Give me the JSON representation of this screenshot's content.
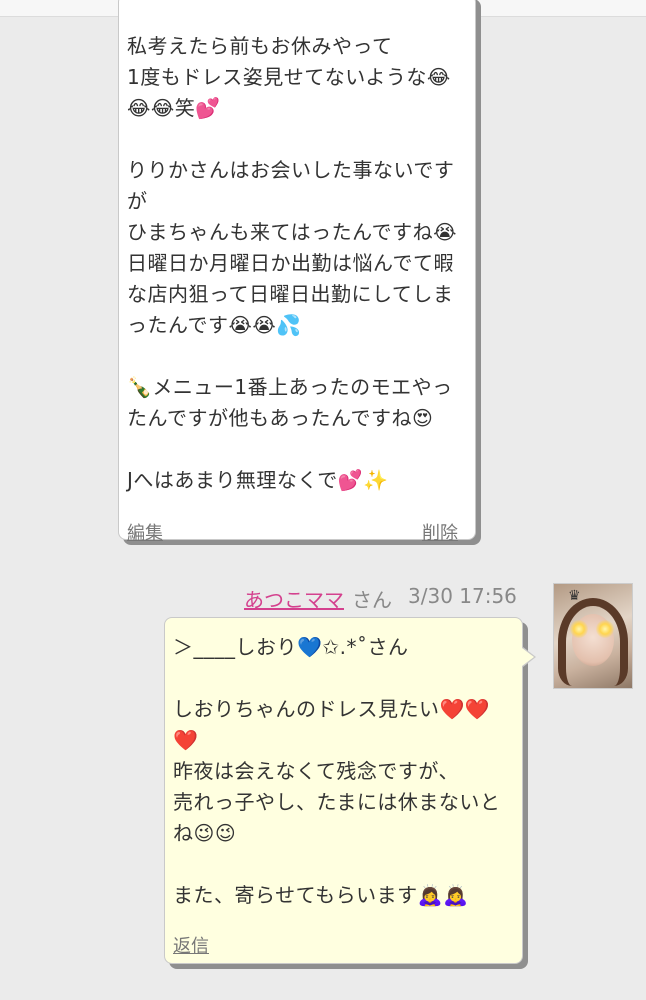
{
  "message1": {
    "lines": [
      "私考えたら前もお休みやって",
      "1度もドレス姿見せてないような😂",
      "😂😂笑💕",
      "",
      "りりかさんはお会いした事ないです",
      "が",
      "ひまちゃんも来てはったんですね😭",
      "日曜日か月曜日か出勤は悩んでて暇",
      "な店内狙って日曜日出勤にしてしま",
      "ったんです😭😭💦",
      "",
      "🍾メニュー1番上あったのモエやっ",
      "たんですが他もあったんですね😍",
      "",
      "Jへはあまり無理なくで💕✨"
    ],
    "edit_label": "編集",
    "delete_label": "削除"
  },
  "message2": {
    "poster": "あつこママ",
    "honorific": "さん",
    "timestamp": "3/30 17:56",
    "lines": [
      "＞____しおり💙✩.*˚さん",
      "",
      "しおりちゃんのドレス見たい❤️❤️",
      "❤️",
      "昨夜は会えなくて残念ですが、",
      "売れっ子やし、たまには休まないと",
      "ね😉😉",
      "",
      "また、寄らせてもらいます🙇‍♀️🙇‍♀️"
    ],
    "reply_label": "返信"
  }
}
